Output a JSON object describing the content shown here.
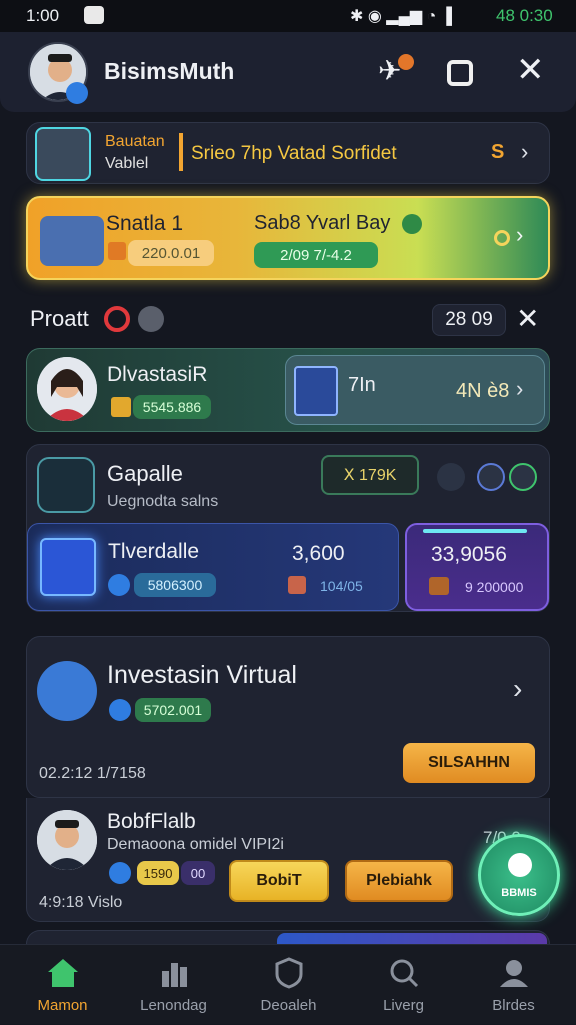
{
  "status": {
    "time": "1:00",
    "right": "48 0:30"
  },
  "header": {
    "title": "BisimsMuth"
  },
  "banner": {
    "title_line1": "Bauatan",
    "title_line2": "Vablel",
    "text": "Srieo 7hp Vatad Sorfidet",
    "badge": "S"
  },
  "promo": {
    "title": "Snatla 1",
    "value": "220.0.01",
    "right_title": "Sab8 Yvarl Bay",
    "right_value": "2/09 7/-4.2"
  },
  "section": {
    "title": "Proatt",
    "value": "28 09"
  },
  "card1": {
    "title": "DlvastasiR",
    "value": "5545.886",
    "mid": "7In",
    "right": "4N è8"
  },
  "card2": {
    "title": "Gapalle",
    "subtitle": "Uegnodta salns",
    "badge": "Ⅹ 179K",
    "sub_title": "Tlverdalle",
    "sub_value": "5806300",
    "amount": "3,600",
    "amount_sub": "104/05",
    "right_amount": "33,9056",
    "right_sub": "9 200000"
  },
  "card3": {
    "title": "Investasin Virtual",
    "value": "5702.001",
    "meta": "02.2:12 1/7158",
    "button": "SILSAHHN"
  },
  "card4": {
    "title": "BobfFlalb",
    "subtitle": "Demaoona omidel VIPI2i",
    "badge1": "1590",
    "badge2": "00",
    "meta": "4:9:18 Vislo",
    "side": "7/0 0",
    "btn1": "BobiT",
    "btn2": "Plebiahk",
    "fab": "BBMIS"
  },
  "nav": [
    {
      "label": "Mamon",
      "active": true
    },
    {
      "label": "Lenondag",
      "active": false
    },
    {
      "label": "Deoaleh",
      "active": false
    },
    {
      "label": "Liverg",
      "active": false
    },
    {
      "label": "Blrdes",
      "active": false
    }
  ],
  "colors": {
    "accent_gold": "#f2a531",
    "accent_green": "#3fc46d",
    "bg": "#141720"
  }
}
